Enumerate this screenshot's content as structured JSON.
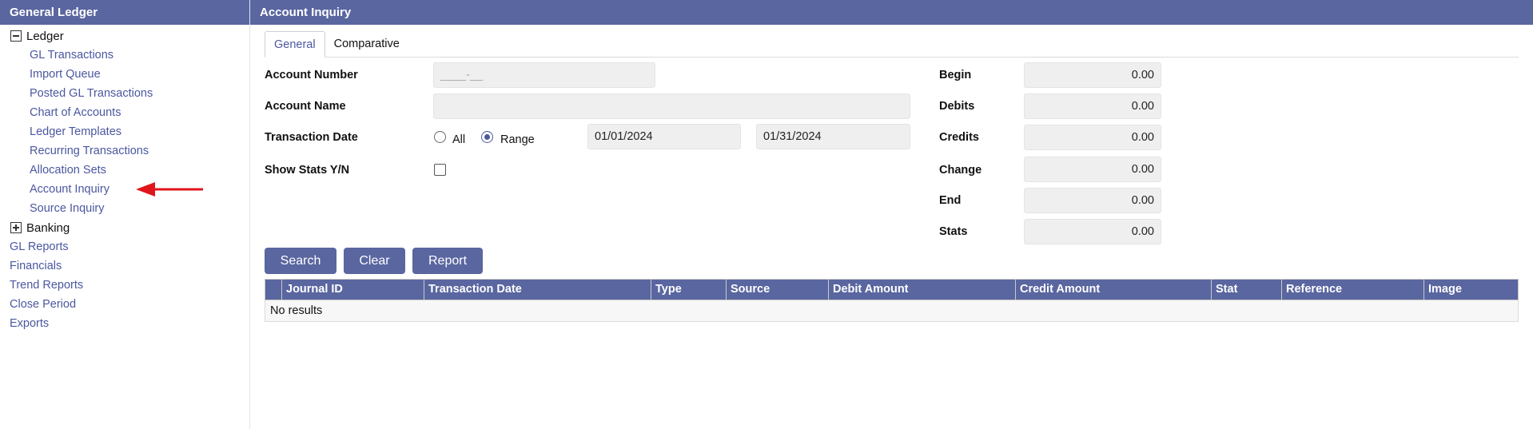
{
  "sidebar": {
    "title": "General Ledger",
    "groups": [
      {
        "label": "Ledger",
        "expanded": true,
        "items": [
          "GL Transactions",
          "Import Queue",
          "Posted GL Transactions",
          "Chart of Accounts",
          "Ledger Templates",
          "Recurring Transactions",
          "Allocation Sets",
          "Account Inquiry",
          "Source Inquiry"
        ]
      },
      {
        "label": "Banking",
        "expanded": false
      }
    ],
    "roots": [
      "GL Reports",
      "Financials",
      "Trend Reports",
      "Close Period",
      "Exports"
    ],
    "pointer_color": "#e0161c"
  },
  "main": {
    "title": "Account Inquiry",
    "tabs": [
      "General",
      "Comparative"
    ],
    "active_tab": "General",
    "form": {
      "account_number_label": "Account Number",
      "account_number_placeholder": "____-__",
      "account_number_value": "",
      "account_name_label": "Account Name",
      "account_name_value": "",
      "transaction_date_label": "Transaction Date",
      "radio_all_label": "All",
      "radio_range_label": "Range",
      "selected_radio": "Range",
      "date_from": "01/01/2024",
      "date_to": "01/31/2024",
      "show_stats_label": "Show Stats Y/N",
      "show_stats_checked": false
    },
    "totals": {
      "begin_label": "Begin",
      "begin": "0.00",
      "debits_label": "Debits",
      "debits": "0.00",
      "credits_label": "Credits",
      "credits": "0.00",
      "change_label": "Change",
      "change": "0.00",
      "end_label": "End",
      "end": "0.00",
      "stats_label": "Stats",
      "stats": "0.00"
    },
    "buttons": {
      "search": "Search",
      "clear": "Clear",
      "report": "Report"
    },
    "grid": {
      "columns": [
        "",
        "Journal ID",
        "Transaction Date",
        "Type",
        "Source",
        "Debit Amount",
        "Credit Amount",
        "Stat",
        "Reference",
        "Image"
      ],
      "empty_text": "No results"
    }
  },
  "colors": {
    "header": "#5a66a0",
    "link": "#4b57a0",
    "field": "#efefef"
  }
}
